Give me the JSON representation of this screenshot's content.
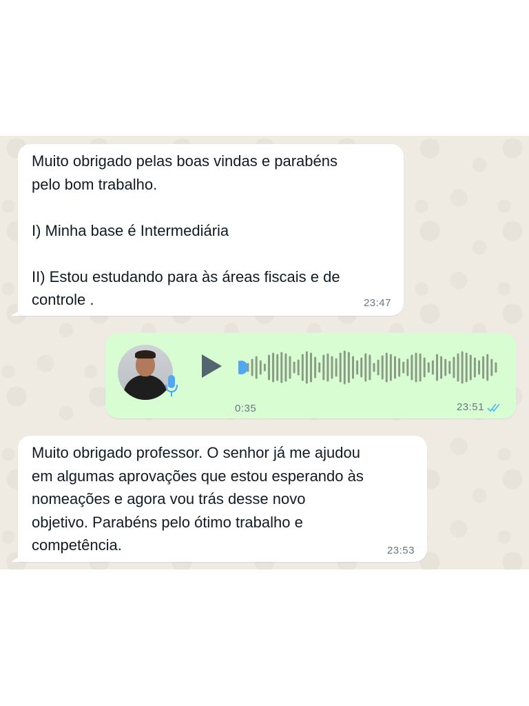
{
  "messages": [
    {
      "direction": "incoming",
      "text": "Muito obrigado pelas boas vindas e parabéns\npelo bom trabalho.\n\nI) Minha base é Intermediária\n\nII) Estou estudando para às áreas fiscais e de\ncontrole .",
      "time": "23:47"
    },
    {
      "direction": "outgoing",
      "type": "voice",
      "duration": "0:35",
      "time": "23:51",
      "status": "read",
      "progress": 0.0
    },
    {
      "direction": "incoming",
      "text": "Muito obrigado professor. O senhor já me ajudou\nem algumas aprovações que estou esperando às\nnomeações e agora vou trás desse novo\nobjetivo. Parabéns pelo ótimo trabalho e\ncompetência.",
      "time": "23:53"
    }
  ],
  "icons": {
    "play": "play-icon",
    "mic": "microphone-icon",
    "read_receipt": "double-check-icon"
  },
  "colors": {
    "incoming_bubble": "#ffffff",
    "outgoing_bubble": "#d9fdd3",
    "chat_background": "#efeae2",
    "waveform": "#8a9a85",
    "playhead": "#53a6f0",
    "read_check": "#53bdeb"
  }
}
